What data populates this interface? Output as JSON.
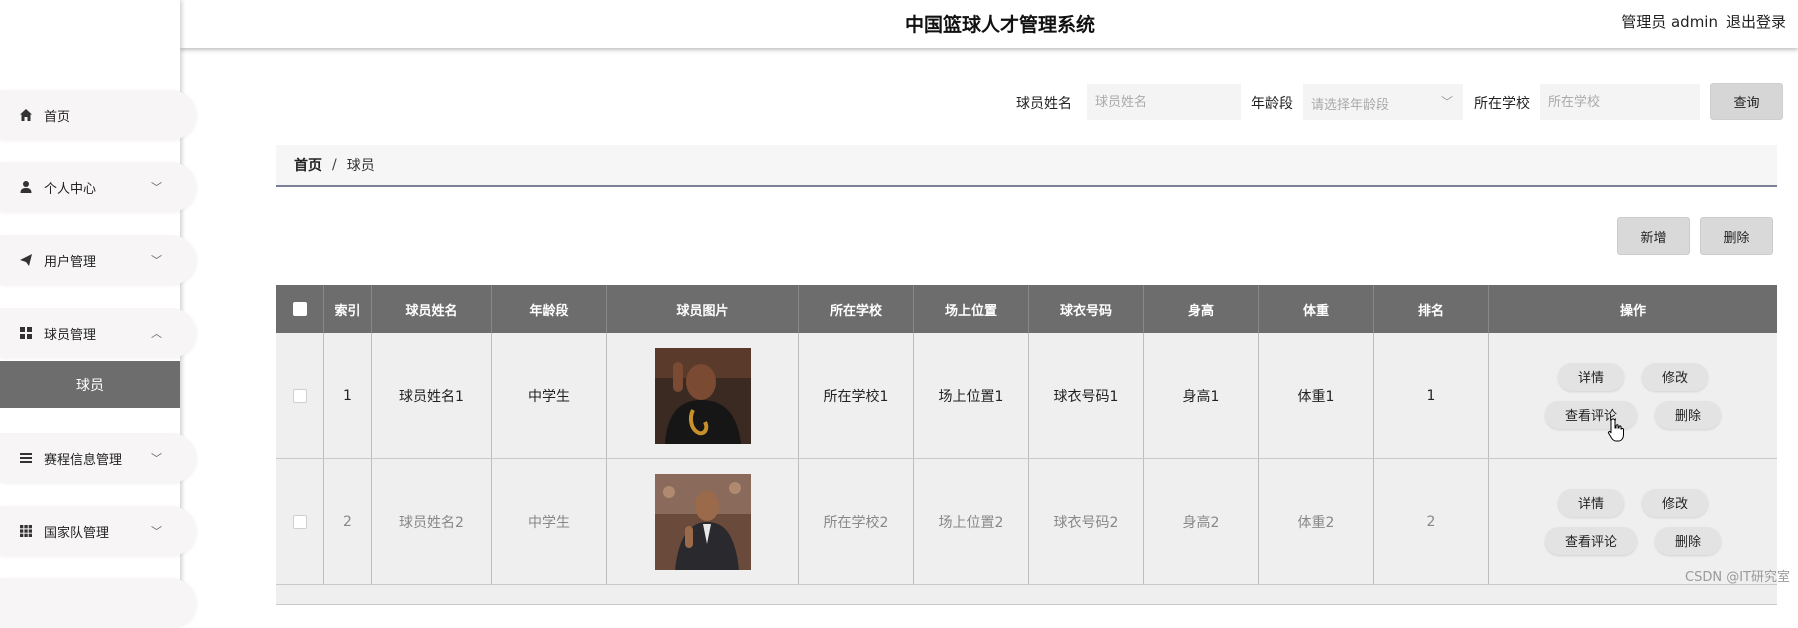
{
  "header": {
    "title": "中国篮球人才管理系统",
    "user": "管理员 admin",
    "logout": "退出登录"
  },
  "sidebar": {
    "items": [
      {
        "label": "首页",
        "icon": "home-icon"
      },
      {
        "label": "个人中心",
        "icon": "person-icon"
      },
      {
        "label": "用户管理",
        "icon": "send-icon"
      },
      {
        "label": "球员管理",
        "icon": "grid-icon",
        "expanded": true
      },
      {
        "label": "赛程信息管理",
        "icon": "list-icon"
      },
      {
        "label": "国家队管理",
        "icon": "grid9-icon"
      }
    ],
    "active_sub": "球员"
  },
  "search": {
    "name_label": "球员姓名",
    "name_placeholder": "球员姓名",
    "age_label": "年龄段",
    "age_placeholder": "请选择年龄段",
    "school_label": "所在学校",
    "school_placeholder": "所在学校",
    "query_button": "查询"
  },
  "breadcrumb": {
    "home": "首页",
    "separator": "/",
    "current": "球员"
  },
  "actions": {
    "add": "新增",
    "delete": "删除"
  },
  "table": {
    "columns": [
      "索引",
      "球员姓名",
      "年龄段",
      "球员图片",
      "所在学校",
      "场上位置",
      "球衣号码",
      "身高",
      "体重",
      "排名",
      "操作"
    ],
    "rows": [
      {
        "index": "1",
        "name": "球员姓名1",
        "age": "中学生",
        "school": "所在学校1",
        "position": "场上位置1",
        "number": "球衣号码1",
        "height": "身高1",
        "weight": "体重1",
        "rank": "1"
      },
      {
        "index": "2",
        "name": "球员姓名2",
        "age": "中学生",
        "school": "所在学校2",
        "position": "场上位置2",
        "number": "球衣号码2",
        "height": "身高2",
        "weight": "体重2",
        "rank": "2"
      }
    ],
    "ops": {
      "detail": "详情",
      "edit": "修改",
      "comments": "查看评论",
      "delete": "删除"
    }
  },
  "watermark": "CSDN @IT研究室",
  "colors": {
    "header_row": "#6d6d6d",
    "active_sub": "#6d6d6d",
    "breadcrumb_border": "#7a8196"
  }
}
